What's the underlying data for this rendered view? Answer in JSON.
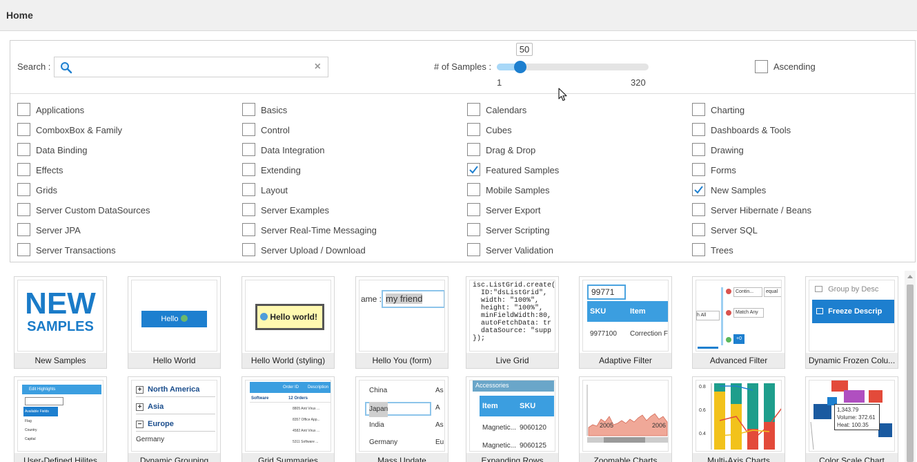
{
  "header": {
    "title": "Home"
  },
  "search": {
    "label": "Search :",
    "value": "",
    "placeholder": ""
  },
  "slider": {
    "label": "# of Samples :",
    "value": "50",
    "min": "1",
    "max": "320",
    "fraction": 0.153
  },
  "sort": {
    "label": "Ascending",
    "checked": false
  },
  "categories": [
    {
      "label": "Applications",
      "checked": false
    },
    {
      "label": "Basics",
      "checked": false
    },
    {
      "label": "Calendars",
      "checked": false
    },
    {
      "label": "Charting",
      "checked": false
    },
    {
      "label": "ComboxBox & Family",
      "checked": false
    },
    {
      "label": "Control",
      "checked": false
    },
    {
      "label": "Cubes",
      "checked": false
    },
    {
      "label": "Dashboards & Tools",
      "checked": false
    },
    {
      "label": "Data Binding",
      "checked": false
    },
    {
      "label": "Data Integration",
      "checked": false
    },
    {
      "label": "Drag & Drop",
      "checked": false
    },
    {
      "label": "Drawing",
      "checked": false
    },
    {
      "label": "Effects",
      "checked": false
    },
    {
      "label": "Extending",
      "checked": false
    },
    {
      "label": "Featured Samples",
      "checked": true
    },
    {
      "label": "Forms",
      "checked": false
    },
    {
      "label": "Grids",
      "checked": false
    },
    {
      "label": "Layout",
      "checked": false
    },
    {
      "label": "Mobile Samples",
      "checked": false
    },
    {
      "label": "New Samples",
      "checked": true
    },
    {
      "label": "Server Custom DataSources",
      "checked": false
    },
    {
      "label": "Server Examples",
      "checked": false
    },
    {
      "label": "Server Export",
      "checked": false
    },
    {
      "label": "Server Hibernate / Beans",
      "checked": false
    },
    {
      "label": "Server JPA",
      "checked": false
    },
    {
      "label": "Server Real-Time Messaging",
      "checked": false
    },
    {
      "label": "Server Scripting",
      "checked": false
    },
    {
      "label": "Server SQL",
      "checked": false
    },
    {
      "label": "Server Transactions",
      "checked": false
    },
    {
      "label": "Server Upload / Download",
      "checked": false
    },
    {
      "label": "Server Validation",
      "checked": false
    },
    {
      "label": "Trees",
      "checked": false
    }
  ],
  "samples": [
    {
      "caption": "New Samples",
      "thumb": {
        "line1": "NEW",
        "line2": "SAMPLES"
      }
    },
    {
      "caption": "Hello World",
      "thumb": {
        "button": "Hello"
      }
    },
    {
      "caption": "Hello World (styling)",
      "thumb": {
        "button": "Hello world!"
      }
    },
    {
      "caption": "Hello You (form)",
      "thumb": {
        "label": "ame :",
        "value": "my friend"
      }
    },
    {
      "caption": "Live Grid",
      "thumb": {
        "code": [
          "isc.ListGrid.create({",
          "  ID:\"dsListGrid\",",
          "  width: \"100%\",",
          "  height: \"100%\",",
          "  minFieldWidth:80,",
          "  autoFetchData: tr",
          "  dataSource: \"supp",
          "});"
        ]
      }
    },
    {
      "caption": "Adaptive Filter",
      "thumb": {
        "filter": "99771",
        "col1": "SKU",
        "col2": "Item",
        "row1": "9977100",
        "row2": "Correction F"
      }
    },
    {
      "caption": "Advanced Filter",
      "thumb": {
        "op1": "Contin...",
        "op2": "Match Any",
        "op3": "equal",
        "left": "h All",
        "btn": "+0"
      }
    },
    {
      "caption": "Dynamic Frozen Colu...",
      "thumb": {
        "item1": "Group by Desc",
        "item2": "Freeze Descrip"
      }
    },
    {
      "caption": "User-Defined Hilites",
      "thumb": {
        "title": "Edit Highlights",
        "field": "Available Fields",
        "rows": [
          "Flag",
          "Country",
          "Capital"
        ]
      }
    },
    {
      "caption": "Dynamic Grouping",
      "thumb": {
        "rows": [
          "North America",
          "Asia",
          "Europe",
          "Germany"
        ]
      }
    },
    {
      "caption": "Grid Summaries",
      "thumb": {
        "h1": "Order ID",
        "h2": "Description",
        "group": "Software",
        "count": "12 Orders",
        "rows": [
          "8805 Anti Virus ...",
          "8357 Office App...",
          "4582 Anti Virus ...",
          "5311 Software ..."
        ]
      }
    },
    {
      "caption": "Mass Update",
      "thumb": {
        "rows": [
          [
            "China",
            "As"
          ],
          [
            "Japan",
            "A"
          ],
          [
            "India",
            "As"
          ],
          [
            "Germany",
            "Eu"
          ]
        ]
      }
    },
    {
      "caption": "Expanding Rows",
      "thumb": {
        "header": "Accessories",
        "col1": "Item",
        "col2": "SKU",
        "row1a": "Magnetic...",
        "row1b": "9060120",
        "row2a": "Magnetic...",
        "row2b": "9060125"
      }
    },
    {
      "caption": "Zoomable Charts",
      "thumb": {
        "x1": "2005",
        "x2": "2006"
      }
    },
    {
      "caption": "Multi-Axis Charts",
      "thumb": {
        "y": [
          "0.8",
          "0.6",
          "0.4"
        ]
      }
    },
    {
      "caption": "Color Scale Chart",
      "thumb": {
        "tip1": "1,343.79",
        "tip2": "Volume: 372.61",
        "tip3": "Heat: 100.35"
      }
    }
  ],
  "colors": {
    "accent": "#1d7fcf",
    "sliderFill": "#a8d8f8",
    "newSamples": "#1a7bc8"
  }
}
